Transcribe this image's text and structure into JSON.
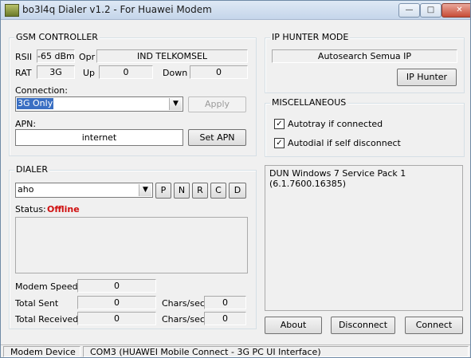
{
  "window": {
    "title": "bo3l4q Dialer v1.2 - For Huawei Modem"
  },
  "gsm": {
    "title": "GSM CONTROLLER",
    "rssi_label": "RSII",
    "rssi": "-65 dBm",
    "opr_label": "Opr",
    "operator": "IND TELKOMSEL",
    "rat_label": "RAT",
    "rat": "3G",
    "up_label": "Up",
    "up": "0",
    "down_label": "Down",
    "down": "0",
    "connection_label": "Connection:",
    "connection": "3G Only",
    "apply_label": "Apply",
    "apn_label": "APN:",
    "apn": "internet",
    "set_apn_label": "Set APN"
  },
  "dialer": {
    "title": "DIALER",
    "profile": "aho",
    "btn_p": "P",
    "btn_n": "N",
    "btn_r": "R",
    "btn_c": "C",
    "btn_d": "D",
    "status_label": "Status:",
    "status": "Offline",
    "modem_speed_label": "Modem Speed",
    "modem_speed": "0",
    "total_sent_label": "Total Sent",
    "total_sent": "0",
    "total_received_label": "Total Received",
    "total_received": "0",
    "chars_label_1": "Chars/sec",
    "chars_sent": "0",
    "chars_label_2": "Chars/sec",
    "chars_received": "0"
  },
  "ip_hunter": {
    "title": "IP HUNTER MODE",
    "mode": "Autosearch Semua IP",
    "button": "IP Hunter"
  },
  "misc": {
    "title": "MISCELLANEOUS",
    "autotray": "Autotray if connected",
    "autodial": "Autodial if self disconnect"
  },
  "info": {
    "text": "DUN Windows 7 Service Pack 1 (6.1.7600.16385)"
  },
  "actions": {
    "about": "About",
    "disconnect": "Disconnect",
    "connect": "Connect"
  },
  "statusbar": {
    "device_label": "Modem Device",
    "device": "COM3 (HUAWEI Mobile Connect - 3G PC UI Interface)"
  }
}
